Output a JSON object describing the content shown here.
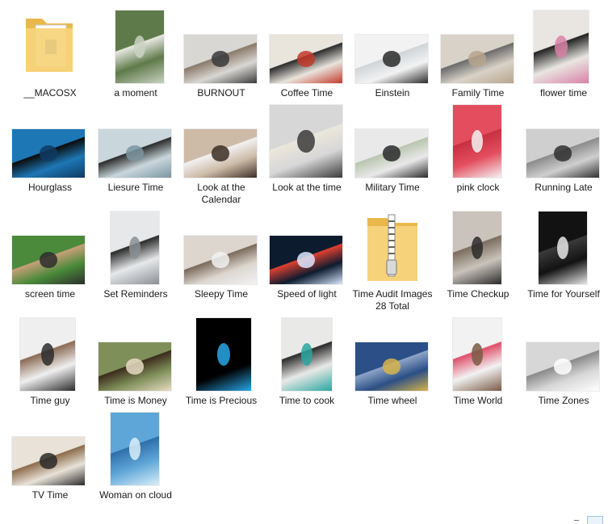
{
  "window": {
    "view": "Large icons"
  },
  "items": [
    {
      "label": "__MACOSX",
      "kind": "folder",
      "icon": "folder-icon"
    },
    {
      "label": "a moment",
      "kind": "image",
      "icon": "photo-thumbnail",
      "colors": [
        "#5f7a4a",
        "#c9d2c2",
        "#e8e8e2"
      ]
    },
    {
      "label": "BURNOUT",
      "kind": "image",
      "icon": "photo-thumbnail",
      "colors": [
        "#d9d7d3",
        "#3a3a3a",
        "#8a7a6a"
      ]
    },
    {
      "label": "Coffee Time",
      "kind": "image",
      "icon": "photo-thumbnail",
      "colors": [
        "#e9e4dc",
        "#c23a2a",
        "#2c2c2c"
      ]
    },
    {
      "label": "Einstein",
      "kind": "image",
      "icon": "photo-thumbnail",
      "colors": [
        "#f2f2f2",
        "#2b2b2b",
        "#cfd4d8"
      ]
    },
    {
      "label": "Family Time",
      "kind": "image",
      "icon": "photo-thumbnail",
      "colors": [
        "#d8d2c8",
        "#b7a58c",
        "#6b6b6b"
      ]
    },
    {
      "label": "flower time",
      "kind": "image",
      "icon": "photo-thumbnail",
      "colors": [
        "#e9e6e2",
        "#d981a6",
        "#222222"
      ]
    },
    {
      "label": "Hourglass",
      "kind": "image",
      "icon": "photo-thumbnail",
      "colors": [
        "#1d77b5",
        "#0f3a63",
        "#0b0b0b"
      ]
    },
    {
      "label": "Liesure Time",
      "kind": "image",
      "icon": "photo-thumbnail",
      "colors": [
        "#c9d7dc",
        "#7b95a0",
        "#2b2b2b"
      ]
    },
    {
      "label": "Look at the Calendar",
      "kind": "image",
      "icon": "photo-thumbnail",
      "colors": [
        "#cdbba8",
        "#3b2e25",
        "#f2f2f2"
      ]
    },
    {
      "label": "Look at the time",
      "kind": "image",
      "icon": "photo-thumbnail",
      "colors": [
        "#d7d7d7",
        "#3b3b3b",
        "#ece7dc"
      ]
    },
    {
      "label": "Military Time",
      "kind": "image",
      "icon": "photo-thumbnail",
      "colors": [
        "#e9e9e9",
        "#2a2a2a",
        "#b8c6b0"
      ]
    },
    {
      "label": "pink clock",
      "kind": "image",
      "icon": "photo-thumbnail",
      "colors": [
        "#e44d5e",
        "#f3f3f3",
        "#c7303f"
      ]
    },
    {
      "label": "Running Late",
      "kind": "image",
      "icon": "photo-thumbnail",
      "colors": [
        "#cfcfcf",
        "#303030",
        "#8c8c8c"
      ]
    },
    {
      "label": "screen time",
      "kind": "image",
      "icon": "photo-thumbnail",
      "colors": [
        "#4a8a3a",
        "#2d2d2d",
        "#c99f7a"
      ]
    },
    {
      "label": "Set Reminders",
      "kind": "image",
      "icon": "photo-thumbnail",
      "colors": [
        "#e6e8ea",
        "#8a8f94",
        "#2a2a2a"
      ]
    },
    {
      "label": "Sleepy Time",
      "kind": "image",
      "icon": "photo-thumbnail",
      "colors": [
        "#dcd6cf",
        "#f2f2f2",
        "#7a6a5a"
      ]
    },
    {
      "label": "Speed of light",
      "kind": "image",
      "icon": "photo-thumbnail",
      "colors": [
        "#0d1b2e",
        "#d9e7ff",
        "#e04030"
      ]
    },
    {
      "label": "Time Audit Images 28 Total",
      "kind": "zip",
      "icon": "zip-folder-icon"
    },
    {
      "label": "Time Checkup",
      "kind": "image",
      "icon": "photo-thumbnail",
      "colors": [
        "#c9c3bb",
        "#2b2b2b",
        "#7b6d5e"
      ]
    },
    {
      "label": "Time for Yourself",
      "kind": "image",
      "icon": "photo-thumbnail",
      "colors": [
        "#121212",
        "#e6e6e6",
        "#3a3a3a"
      ]
    },
    {
      "label": "Time guy",
      "kind": "image",
      "icon": "photo-thumbnail",
      "colors": [
        "#efefef",
        "#2b2b2b",
        "#8b6b55"
      ]
    },
    {
      "label": "Time is Money",
      "kind": "image",
      "icon": "photo-thumbnail",
      "colors": [
        "#7f8f5a",
        "#e8dcc2",
        "#3b2b1b"
      ]
    },
    {
      "label": "Time is Precious",
      "kind": "image",
      "icon": "photo-thumbnail",
      "colors": [
        "#000000",
        "#29a6e8",
        "#000000"
      ]
    },
    {
      "label": "Time to cook",
      "kind": "image",
      "icon": "photo-thumbnail",
      "colors": [
        "#e9e9e7",
        "#2aa6a0",
        "#2b2b2b"
      ]
    },
    {
      "label": "Time wheel",
      "kind": "image",
      "icon": "photo-thumbnail",
      "colors": [
        "#2b4f86",
        "#d7b44a",
        "#8ea4c7"
      ]
    },
    {
      "label": "Time World",
      "kind": "image",
      "icon": "photo-thumbnail",
      "colors": [
        "#f2f2f2",
        "#7a5a45",
        "#e0506a"
      ]
    },
    {
      "label": "Time Zones",
      "kind": "image",
      "icon": "photo-thumbnail",
      "colors": [
        "#d7d7d7",
        "#ffffff",
        "#8a8a8a"
      ]
    },
    {
      "label": "TV Time",
      "kind": "image",
      "icon": "photo-thumbnail",
      "colors": [
        "#e8e2d8",
        "#2a2a2a",
        "#8b6b4a"
      ]
    },
    {
      "label": "Woman on cloud",
      "kind": "image",
      "icon": "photo-thumbnail",
      "colors": [
        "#5fa6d8",
        "#d9eef9",
        "#2f6fa8"
      ]
    }
  ]
}
